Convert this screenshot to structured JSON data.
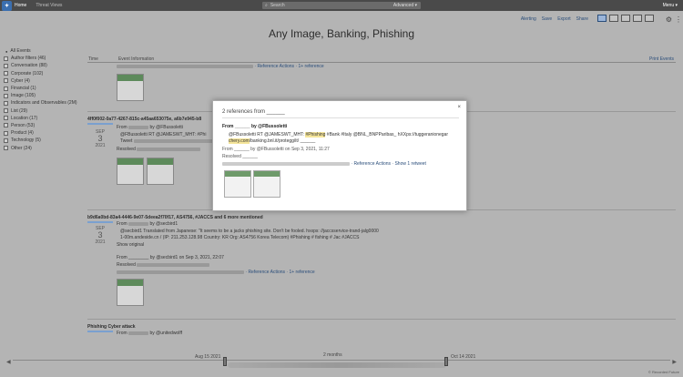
{
  "topbar": {
    "logo_text": "✦",
    "home": "Home",
    "threat_views": "Threat Views",
    "search_placeholder": "Search",
    "advanced": "Advanced ▾",
    "menu": "Menu ▾"
  },
  "toolbar": {
    "alerting": "Alerting",
    "save": "Save",
    "export": "Export",
    "share": "Share"
  },
  "page_title": "Any Image, Banking, Phishing",
  "left_panel": {
    "all_events": "All Events",
    "items": [
      "Author filters (46)",
      "Conversation (88)",
      "Corporate (102)",
      "Cyber (4)",
      "Financial (1)",
      "Image (105)",
      "Indicators and Observables (2M)",
      "List (29)",
      "Location (17)",
      "Person (53)",
      "Product (4)",
      "Technology (5)",
      "Other (24)"
    ]
  },
  "columns": {
    "time": "Time",
    "event_info": "Event Information",
    "print": "Print Events"
  },
  "events": {
    "e0_actions": "· Reference Actions · 1+ reference",
    "e1": {
      "title": "4ff0f002-0a77-4267-815c-a45aa653075e, a6b7e945-b8",
      "from": "From",
      "by": "by @FBussoletti",
      "mon": "SEP",
      "day": "3",
      "yr": "2021",
      "rt": "@FBussoletti RT @JAMESWT_MHT: #Phi",
      "tw": "Tweet",
      "resolved": "Resolved"
    },
    "e2": {
      "title": "b9d6a0bd-83a4-4446-9e07-5deea2f70f17, AS4756, #JACCS and 6 more mentioned",
      "from": "From",
      "by": "by @secbird1",
      "mon": "SEP",
      "day": "3",
      "yr": "2021",
      "text1": "@secbird1 Translated from Japanese: \"It seems to be a jacks phishing site. Don't be fooled. hxxps: //jaccsservice-trand-jalg0000",
      "text2": "1-00m.andeside.cn / (IP: 211.253.128.98 Country: KR Org: AS4756 Korea Telecom) #Phishing # fishing # Jac #JACCS",
      "show_original": "Show original",
      "meta": "From ________ by @secbird1 on Sep 3, 2021, 22:07",
      "resolved": "Resolved",
      "actions": "· Reference Actions · 1+ reference"
    },
    "e3": {
      "title": "Phishing Cyber attack",
      "from": "From",
      "by": "by @unitedwolff"
    }
  },
  "modal": {
    "title": "2 references from ______",
    "close": "×",
    "from": "From ______ by @FBussoletti",
    "text_a": "@FBussoletti RT @JAMESWT_MHT: ",
    "text_hl": "#Phishing",
    "text_b": " #Bank #Italy @BNL_BNPParibas_ hXXps://tuggeranionegar",
    "text_c": "chery.com",
    "text_d": "/banking.bnl.it/protegg/it/ ______",
    "meta": "From ______ by @FBussoletti on Sep 3, 2021, 11:27",
    "resolved": "Resolved ______",
    "actions": "· Reference Actions · Show 1 retweet"
  },
  "timeline": {
    "start": "Aug 15 2021",
    "mid": "2 months",
    "end": "Oct 14 2021",
    "credit": "© Recorded Future"
  }
}
